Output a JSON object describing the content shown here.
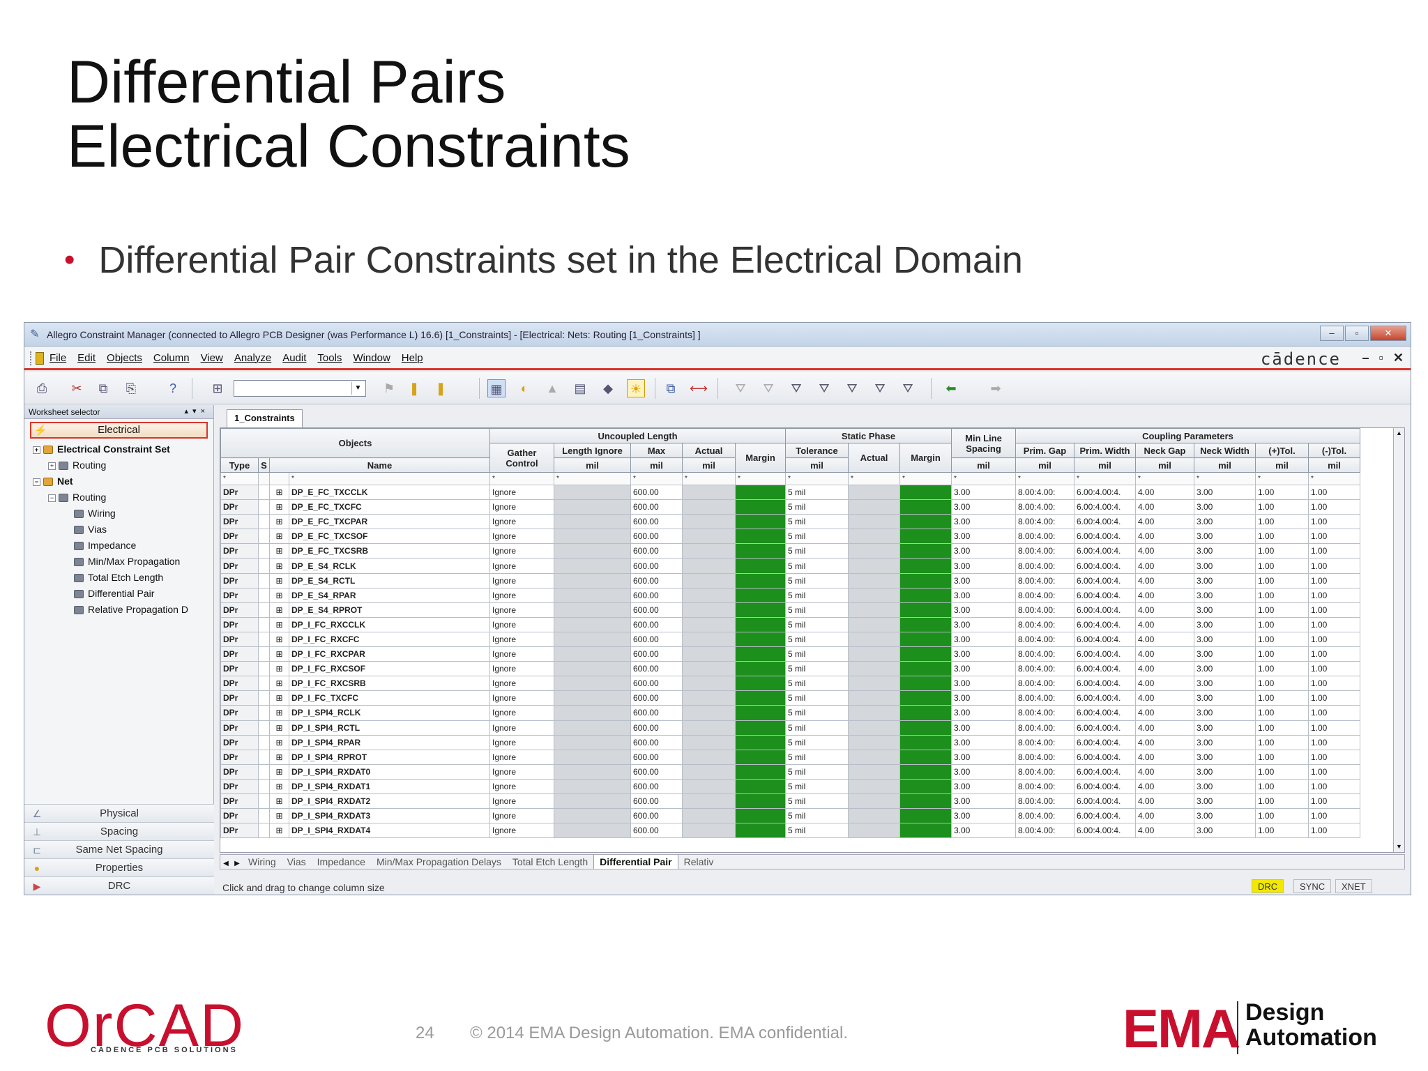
{
  "slide": {
    "title_line1": "Differential Pairs",
    "title_line2": "Electrical Constraints",
    "bullet": "Differential Pair Constraints set in the Electrical Domain",
    "page_number": "24",
    "copyright": "© 2014 EMA Design Automation. EMA confidential.",
    "logo_orcad": "OrCAD",
    "logo_orcad_sub": "CADENCE PCB SOLUTIONS",
    "logo_ema": "EMA",
    "logo_ema_sub1": "Design",
    "logo_ema_sub2": "Automation"
  },
  "window": {
    "title": "Allegro Constraint Manager (connected to Allegro PCB Designer (was Performance L) 16.6) [1_Constraints] - [Electrical: Nets: Routing [1_Constraints] ]",
    "brand": "cādence",
    "controls": {
      "minimize": "–",
      "restore": "▫",
      "close": "✕"
    }
  },
  "menu": [
    "File",
    "Edit",
    "Objects",
    "Column",
    "View",
    "Analyze",
    "Audit",
    "Tools",
    "Window",
    "Help"
  ],
  "sidebar": {
    "header": "Worksheet selector",
    "electrical": "Electrical",
    "tree": [
      {
        "label": "Electrical Constraint Set",
        "level": 0,
        "bold": true,
        "expander": "+",
        "icon": "folder"
      },
      {
        "label": "Routing",
        "level": 1,
        "bold": false,
        "expander": "+",
        "icon": "sheet"
      },
      {
        "label": "Net",
        "level": 0,
        "bold": true,
        "expander": "−",
        "icon": "folder"
      },
      {
        "label": "Routing",
        "level": 1,
        "bold": false,
        "expander": "−",
        "icon": "sheet"
      },
      {
        "label": "Wiring",
        "level": 2,
        "bold": false,
        "expander": "",
        "icon": "sheet"
      },
      {
        "label": "Vias",
        "level": 2,
        "bold": false,
        "expander": "",
        "icon": "sheet"
      },
      {
        "label": "Impedance",
        "level": 2,
        "bold": false,
        "expander": "",
        "icon": "sheet"
      },
      {
        "label": "Min/Max Propagation",
        "level": 2,
        "bold": false,
        "expander": "",
        "icon": "sheet"
      },
      {
        "label": "Total Etch Length",
        "level": 2,
        "bold": false,
        "expander": "",
        "icon": "sheet"
      },
      {
        "label": "Differential Pair",
        "level": 2,
        "bold": false,
        "expander": "",
        "icon": "sheet"
      },
      {
        "label": "Relative Propagation D",
        "level": 2,
        "bold": false,
        "expander": "",
        "icon": "sheet"
      }
    ],
    "domains": [
      "Physical",
      "Spacing",
      "Same Net Spacing",
      "Properties",
      "DRC"
    ]
  },
  "grid": {
    "sheet_tab": "1_Constraints",
    "groups": {
      "objects": "Objects",
      "uncoupled": "Uncoupled Length",
      "static_phase": "Static Phase",
      "min_line_spacing": "Min Line Spacing",
      "coupling": "Coupling Parameters"
    },
    "headers": {
      "type": "Type",
      "s": "S",
      "name": "Name",
      "gather": "Gather Control",
      "length_ignore": "Length Ignore",
      "max": "Max",
      "actual": "Actual",
      "margin": "Margin",
      "tolerance": "Tolerance",
      "sp_actual": "Actual",
      "sp_margin": "Margin",
      "prim_gap": "Prim. Gap",
      "prim_width": "Prim. Width",
      "neck_gap": "Neck Gap",
      "neck_width": "Neck Width",
      "plus_tol": "(+)Tol.",
      "minus_tol": "(-)Tol."
    },
    "unit": "mil",
    "rows": [
      {
        "type": "DPr",
        "name": "DP_E_FC_TXCCLK",
        "gather": "Ignore",
        "max": "600.00",
        "tol": "5 mil",
        "mls": "3.00",
        "pgap": "8.00:4.00:",
        "pwidth": "6.00:4.00:4.",
        "ngap": "4.00",
        "nwidth": "3.00",
        "ptol": "1.00",
        "mtol": "1.00"
      },
      {
        "type": "DPr",
        "name": "DP_E_FC_TXCFC",
        "gather": "Ignore",
        "max": "600.00",
        "tol": "5 mil",
        "mls": "3.00",
        "pgap": "8.00:4.00:",
        "pwidth": "6.00:4.00:4.",
        "ngap": "4.00",
        "nwidth": "3.00",
        "ptol": "1.00",
        "mtol": "1.00"
      },
      {
        "type": "DPr",
        "name": "DP_E_FC_TXCPAR",
        "gather": "Ignore",
        "max": "600.00",
        "tol": "5 mil",
        "mls": "3.00",
        "pgap": "8.00:4.00:",
        "pwidth": "6.00:4.00:4.",
        "ngap": "4.00",
        "nwidth": "3.00",
        "ptol": "1.00",
        "mtol": "1.00"
      },
      {
        "type": "DPr",
        "name": "DP_E_FC_TXCSOF",
        "gather": "Ignore",
        "max": "600.00",
        "tol": "5 mil",
        "mls": "3.00",
        "pgap": "8.00:4.00:",
        "pwidth": "6.00:4.00:4.",
        "ngap": "4.00",
        "nwidth": "3.00",
        "ptol": "1.00",
        "mtol": "1.00"
      },
      {
        "type": "DPr",
        "name": "DP_E_FC_TXCSRB",
        "gather": "Ignore",
        "max": "600.00",
        "tol": "5 mil",
        "mls": "3.00",
        "pgap": "8.00:4.00:",
        "pwidth": "6.00:4.00:4.",
        "ngap": "4.00",
        "nwidth": "3.00",
        "ptol": "1.00",
        "mtol": "1.00"
      },
      {
        "type": "DPr",
        "name": "DP_E_S4_RCLK",
        "gather": "Ignore",
        "max": "600.00",
        "tol": "5 mil",
        "mls": "3.00",
        "pgap": "8.00:4.00:",
        "pwidth": "6.00:4.00:4.",
        "ngap": "4.00",
        "nwidth": "3.00",
        "ptol": "1.00",
        "mtol": "1.00"
      },
      {
        "type": "DPr",
        "name": "DP_E_S4_RCTL",
        "gather": "Ignore",
        "max": "600.00",
        "tol": "5 mil",
        "mls": "3.00",
        "pgap": "8.00:4.00:",
        "pwidth": "6.00:4.00:4.",
        "ngap": "4.00",
        "nwidth": "3.00",
        "ptol": "1.00",
        "mtol": "1.00"
      },
      {
        "type": "DPr",
        "name": "DP_E_S4_RPAR",
        "gather": "Ignore",
        "max": "600.00",
        "tol": "5 mil",
        "mls": "3.00",
        "pgap": "8.00:4.00:",
        "pwidth": "6.00:4.00:4.",
        "ngap": "4.00",
        "nwidth": "3.00",
        "ptol": "1.00",
        "mtol": "1.00"
      },
      {
        "type": "DPr",
        "name": "DP_E_S4_RPROT",
        "gather": "Ignore",
        "max": "600.00",
        "tol": "5 mil",
        "mls": "3.00",
        "pgap": "8.00:4.00:",
        "pwidth": "6.00:4.00:4.",
        "ngap": "4.00",
        "nwidth": "3.00",
        "ptol": "1.00",
        "mtol": "1.00"
      },
      {
        "type": "DPr",
        "name": "DP_I_FC_RXCCLK",
        "gather": "Ignore",
        "max": "600.00",
        "tol": "5 mil",
        "mls": "3.00",
        "pgap": "8.00:4.00:",
        "pwidth": "6.00:4.00:4.",
        "ngap": "4.00",
        "nwidth": "3.00",
        "ptol": "1.00",
        "mtol": "1.00"
      },
      {
        "type": "DPr",
        "name": "DP_I_FC_RXCFC",
        "gather": "Ignore",
        "max": "600.00",
        "tol": "5 mil",
        "mls": "3.00",
        "pgap": "8.00:4.00:",
        "pwidth": "6.00:4.00:4.",
        "ngap": "4.00",
        "nwidth": "3.00",
        "ptol": "1.00",
        "mtol": "1.00"
      },
      {
        "type": "DPr",
        "name": "DP_I_FC_RXCPAR",
        "gather": "Ignore",
        "max": "600.00",
        "tol": "5 mil",
        "mls": "3.00",
        "pgap": "8.00:4.00:",
        "pwidth": "6.00:4.00:4.",
        "ngap": "4.00",
        "nwidth": "3.00",
        "ptol": "1.00",
        "mtol": "1.00"
      },
      {
        "type": "DPr",
        "name": "DP_I_FC_RXCSOF",
        "gather": "Ignore",
        "max": "600.00",
        "tol": "5 mil",
        "mls": "3.00",
        "pgap": "8.00:4.00:",
        "pwidth": "6.00:4.00:4.",
        "ngap": "4.00",
        "nwidth": "3.00",
        "ptol": "1.00",
        "mtol": "1.00"
      },
      {
        "type": "DPr",
        "name": "DP_I_FC_RXCSRB",
        "gather": "Ignore",
        "max": "600.00",
        "tol": "5 mil",
        "mls": "3.00",
        "pgap": "8.00:4.00:",
        "pwidth": "6.00:4.00:4.",
        "ngap": "4.00",
        "nwidth": "3.00",
        "ptol": "1.00",
        "mtol": "1.00"
      },
      {
        "type": "DPr",
        "name": "DP_I_FC_TXCFC",
        "gather": "Ignore",
        "max": "600.00",
        "tol": "5 mil",
        "mls": "3.00",
        "pgap": "8.00:4.00:",
        "pwidth": "6.00:4.00:4.",
        "ngap": "4.00",
        "nwidth": "3.00",
        "ptol": "1.00",
        "mtol": "1.00"
      },
      {
        "type": "DPr",
        "name": "DP_I_SPI4_RCLK",
        "gather": "Ignore",
        "max": "600.00",
        "tol": "5 mil",
        "mls": "3.00",
        "pgap": "8.00:4.00:",
        "pwidth": "6.00:4.00:4.",
        "ngap": "4.00",
        "nwidth": "3.00",
        "ptol": "1.00",
        "mtol": "1.00"
      },
      {
        "type": "DPr",
        "name": "DP_I_SPI4_RCTL",
        "gather": "Ignore",
        "max": "600.00",
        "tol": "5 mil",
        "mls": "3.00",
        "pgap": "8.00:4.00:",
        "pwidth": "6.00:4.00:4.",
        "ngap": "4.00",
        "nwidth": "3.00",
        "ptol": "1.00",
        "mtol": "1.00"
      },
      {
        "type": "DPr",
        "name": "DP_I_SPI4_RPAR",
        "gather": "Ignore",
        "max": "600.00",
        "tol": "5 mil",
        "mls": "3.00",
        "pgap": "8.00:4.00:",
        "pwidth": "6.00:4.00:4.",
        "ngap": "4.00",
        "nwidth": "3.00",
        "ptol": "1.00",
        "mtol": "1.00"
      },
      {
        "type": "DPr",
        "name": "DP_I_SPI4_RPROT",
        "gather": "Ignore",
        "max": "600.00",
        "tol": "5 mil",
        "mls": "3.00",
        "pgap": "8.00:4.00:",
        "pwidth": "6.00:4.00:4.",
        "ngap": "4.00",
        "nwidth": "3.00",
        "ptol": "1.00",
        "mtol": "1.00"
      },
      {
        "type": "DPr",
        "name": "DP_I_SPI4_RXDAT0",
        "gather": "Ignore",
        "max": "600.00",
        "tol": "5 mil",
        "mls": "3.00",
        "pgap": "8.00:4.00:",
        "pwidth": "6.00:4.00:4.",
        "ngap": "4.00",
        "nwidth": "3.00",
        "ptol": "1.00",
        "mtol": "1.00"
      },
      {
        "type": "DPr",
        "name": "DP_I_SPI4_RXDAT1",
        "gather": "Ignore",
        "max": "600.00",
        "tol": "5 mil",
        "mls": "3.00",
        "pgap": "8.00:4.00:",
        "pwidth": "6.00:4.00:4.",
        "ngap": "4.00",
        "nwidth": "3.00",
        "ptol": "1.00",
        "mtol": "1.00"
      },
      {
        "type": "DPr",
        "name": "DP_I_SPI4_RXDAT2",
        "gather": "Ignore",
        "max": "600.00",
        "tol": "5 mil",
        "mls": "3.00",
        "pgap": "8.00:4.00:",
        "pwidth": "6.00:4.00:4.",
        "ngap": "4.00",
        "nwidth": "3.00",
        "ptol": "1.00",
        "mtol": "1.00"
      },
      {
        "type": "DPr",
        "name": "DP_I_SPI4_RXDAT3",
        "gather": "Ignore",
        "max": "600.00",
        "tol": "5 mil",
        "mls": "3.00",
        "pgap": "8.00:4.00:",
        "pwidth": "6.00:4.00:4.",
        "ngap": "4.00",
        "nwidth": "3.00",
        "ptol": "1.00",
        "mtol": "1.00"
      },
      {
        "type": "DPr",
        "name": "DP_I_SPI4_RXDAT4",
        "gather": "Ignore",
        "max": "600.00",
        "tol": "5 mil",
        "mls": "3.00",
        "pgap": "8.00:4.00:",
        "pwidth": "6.00:4.00:4.",
        "ngap": "4.00",
        "nwidth": "3.00",
        "ptol": "1.00",
        "mtol": "1.00"
      }
    ],
    "colors": {
      "margin_pass": "#1c8f1c",
      "readonly": "#d4d7db"
    }
  },
  "bottom_tabs": [
    "Wiring",
    "Vias",
    "Impedance",
    "Min/Max Propagation Delays",
    "Total Etch Length",
    "Differential Pair",
    "Relativ"
  ],
  "active_bottom_tab": "Differential Pair",
  "status": {
    "message": "Click and drag to change column size",
    "drc": "DRC",
    "sync": "SYNC",
    "xnet": "XNET"
  }
}
